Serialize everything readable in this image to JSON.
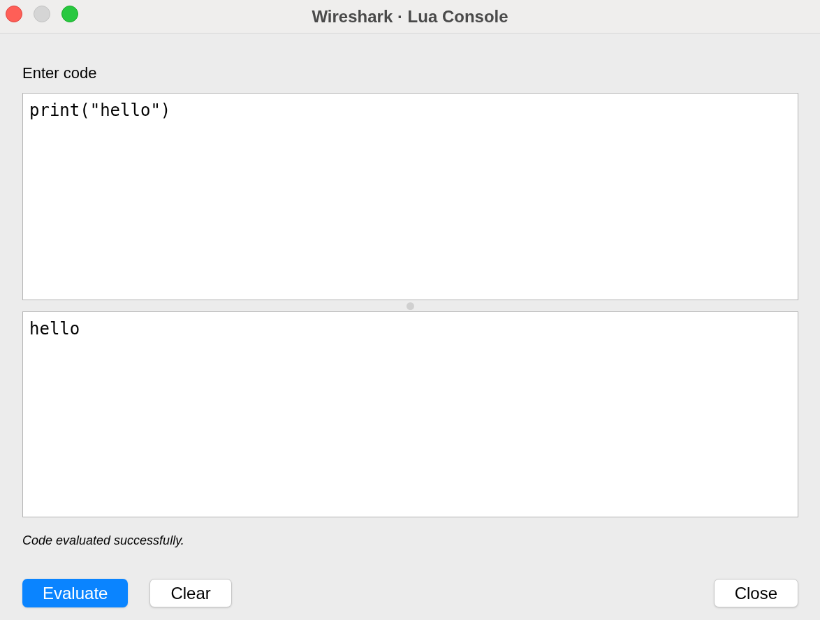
{
  "window": {
    "title": "Wireshark · Lua Console"
  },
  "input_label": "Enter code",
  "code_editor": {
    "value": "print(\"hello\")"
  },
  "output": {
    "value": "hello"
  },
  "status": "Code evaluated successfully.",
  "buttons": [
    {
      "label": "Evaluate",
      "kind": "primary",
      "trailing": false
    },
    {
      "label": "Clear",
      "kind": "secondary",
      "trailing": false
    },
    {
      "label": "Close",
      "kind": "secondary",
      "trailing": true
    }
  ]
}
